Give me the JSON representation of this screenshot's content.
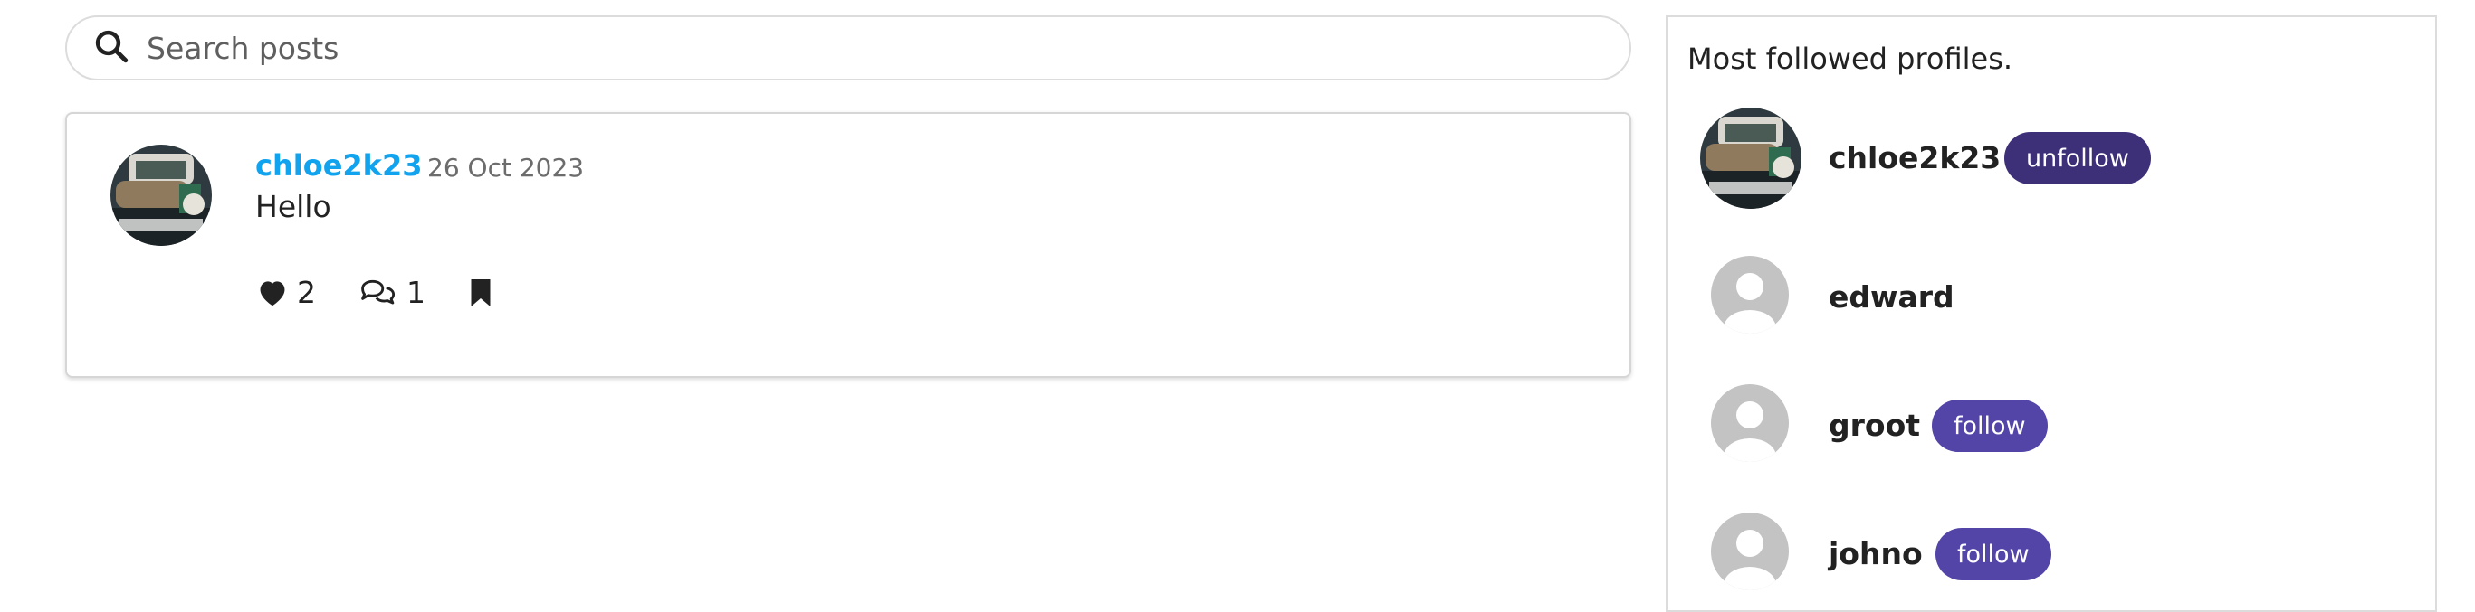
{
  "search": {
    "placeholder": "Search posts",
    "icon": "search-icon"
  },
  "post": {
    "username": "chloe2k23",
    "date": "26 Oct 2023",
    "body": "Hello",
    "likes": "2",
    "comments": "1",
    "icons": [
      "heart-icon",
      "comment-icon",
      "bookmark-icon"
    ]
  },
  "sidebar": {
    "title": "Most followed profiles.",
    "profiles": [
      {
        "name": "chloe2k23",
        "button": "unfollow",
        "avatar": "photo"
      },
      {
        "name": "edward",
        "button": "",
        "avatar": "default"
      },
      {
        "name": "groot",
        "button": "follow",
        "avatar": "default"
      },
      {
        "name": "johno",
        "button": "follow",
        "avatar": "default"
      }
    ]
  },
  "colors": {
    "link": "#12a3ef",
    "unfollow_button": "#3e2f79",
    "follow_button": "#5344a8",
    "default_avatar": "#c3c3c3"
  }
}
